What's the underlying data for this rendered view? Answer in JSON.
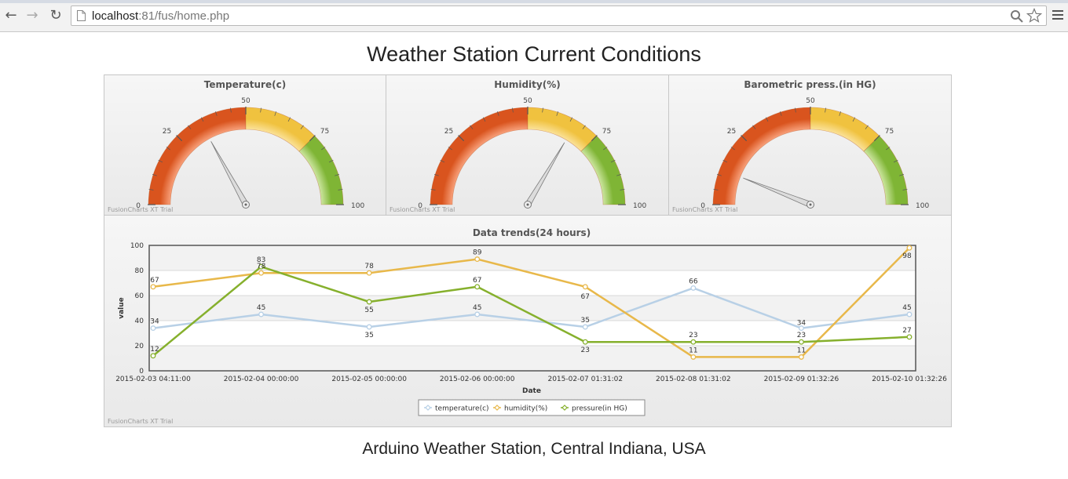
{
  "browser": {
    "url_host": "localhost",
    "url_rest": ":81/fus/home.php",
    "back_icon": "back-arrow-icon",
    "forward_icon": "forward-arrow-icon",
    "reload_icon": "reload-icon"
  },
  "page": {
    "title": "Weather Station Current Conditions",
    "footer": "Arduino Weather Station, Central Indiana, USA",
    "trial_label": "FusionCharts XT Trial"
  },
  "colors": {
    "gauge_red": "#d9541e",
    "gauge_yellow": "#f0c23f",
    "gauge_green": "#7fb535",
    "temperature": "#b8d0e6",
    "humidity": "#e8b84a",
    "pressure": "#86b02d"
  },
  "gauges": [
    {
      "title": "Temperature(c)",
      "value": 34,
      "min": 0,
      "max": 100,
      "ticks": [
        "0",
        "25",
        "50",
        "75",
        "100"
      ]
    },
    {
      "title": "Humidity(%)",
      "value": 67,
      "min": 0,
      "max": 100,
      "ticks": [
        "0",
        "25",
        "50",
        "75",
        "100"
      ]
    },
    {
      "title": "Barometric press.(in HG)",
      "value": 12,
      "min": 0,
      "max": 100,
      "ticks": [
        "0",
        "25",
        "50",
        "75",
        "100"
      ]
    }
  ],
  "chart_data": {
    "type": "line",
    "title": "Data trends(24 hours)",
    "xlabel": "Date",
    "ylabel": "value",
    "ylim": [
      0,
      100
    ],
    "yticks": [
      0,
      20,
      40,
      60,
      80,
      100
    ],
    "categories": [
      "2015-02-03 04:11:00",
      "2015-02-04 00:00:00",
      "2015-02-05 00:00:00",
      "2015-02-06 00:00:00",
      "2015-02-07 01:31:02",
      "2015-02-08 01:31:02",
      "2015-02-09 01:32:26",
      "2015-02-10 01:32:26"
    ],
    "series": [
      {
        "name": "temperature(c)",
        "color": "#b8d0e6",
        "values": [
          34,
          45,
          35,
          45,
          35,
          66,
          34,
          45
        ]
      },
      {
        "name": "humidity(%)",
        "color": "#e8b84a",
        "values": [
          67,
          78,
          78,
          89,
          67,
          11,
          11,
          98
        ]
      },
      {
        "name": "pressure(in HG)",
        "color": "#86b02d",
        "values": [
          12,
          83,
          55,
          67,
          23,
          23,
          23,
          27
        ]
      }
    ],
    "grid": true,
    "legend": "bottom-center"
  }
}
